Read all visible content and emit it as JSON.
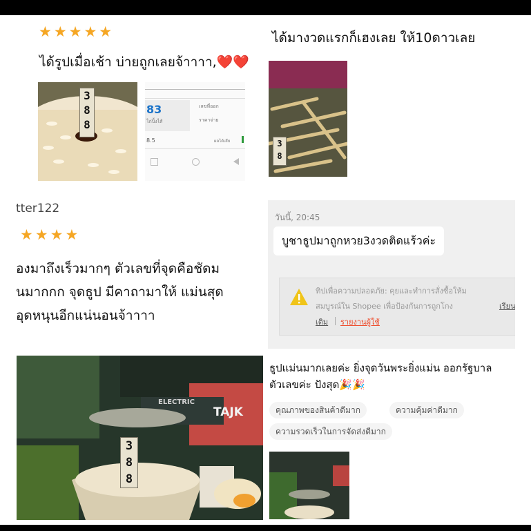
{
  "review1": {
    "stars": "★★★★★",
    "text": "ได้รูปเมื่อเช้า บ่ายถูกเลยจ้าาาา,❤️❤️",
    "rice_tag": "3 8 8",
    "phone_number": "83",
    "phone_small1": "ไก่ปิ้งไส้",
    "phone_small2": "เลขที่ออก",
    "phone_small3": "ราคาจ่าย",
    "phone_value": "8.5",
    "phone_small4": "ผลได้เสีย"
  },
  "review2": {
    "text": "ได้มางวดแรกก็เฮงเลย ให้10ดาวเลย",
    "tag": "3 8"
  },
  "review3": {
    "username": "tter122",
    "stars": "★★★★",
    "line1": "องมาถึงเร็วมากๆ ตัวเลขที่จุดคือชัดม",
    "line2": "่นมากกก จุดธูป มีคาถามาให้ แม่นสุด",
    "line3": "อุดหนุนอีกแน่นอนจ้าาาา"
  },
  "chat": {
    "timestamp": "วันนี้, 20:45",
    "message": "บูชาธูปมาถูกหวย3งวดติดแร้วค่ะ",
    "warning_line1": "ทิปเพื่อความปลอดภัย: คุยและทำการสั่งซื้อให้ม",
    "warning_line2": "สมบูรณ์ใน Shopee เพื่อป้องกันการถูกโกง",
    "warning_link": "เรียน",
    "warning_line3_prefix": "เติม",
    "report_link": "รายงานผู้ใช้"
  },
  "review4": {
    "line1": "ธูปแม่นมากเลยค่ะ ยิ่งจุดวันพระยิ่งแม่น ออกรัฐบาล",
    "line2": "ตัวเลขค่ะ ปังสุด🎉🎉",
    "chips": [
      "คุณภาพของสินค้าดีมาก",
      "ความคุ้มค่าดีมาก",
      "ความรวดเร็วในการจัดส่งดีมาก"
    ]
  },
  "photo_large": {
    "tag": "3 8 8",
    "sign1": "ELECTRIC",
    "sign2": "TAJK"
  },
  "colors": {
    "star": "#f5a623",
    "link": "#ee4d2d",
    "chat_bg": "#f0f0f0",
    "warning": "#f0c419"
  }
}
